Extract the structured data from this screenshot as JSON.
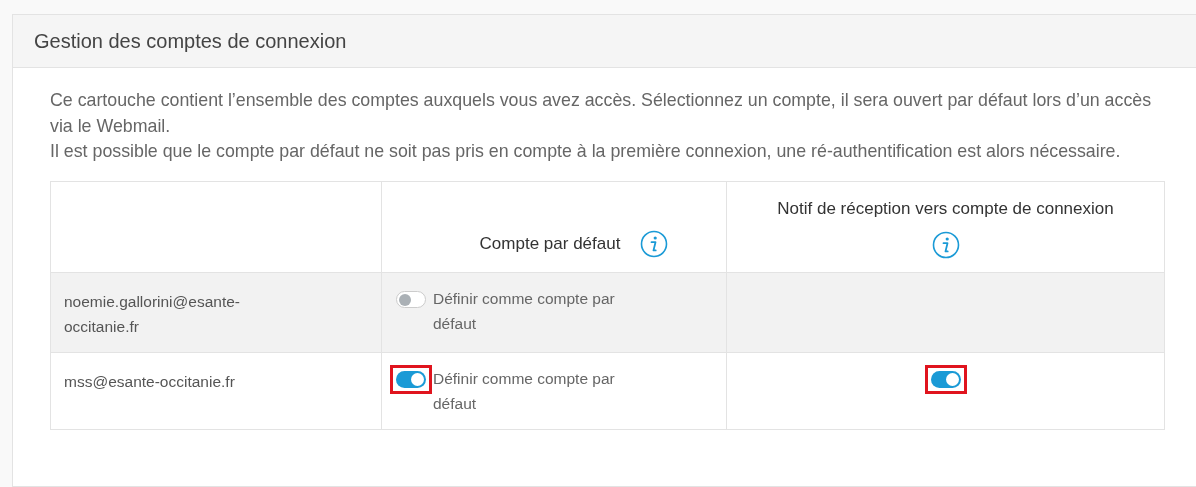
{
  "panel": {
    "title": "Gestion des comptes de connexion"
  },
  "paragraphs": [
    "Ce cartouche contient l’ensemble des comptes auxquels vous avez accès. Sélectionnez un compte, il sera ouvert par défaut lors d’un accès via le Webmail.",
    "Il est possible que le compte par défaut ne soit pas pris en compte à la première connexion, une ré-authentification est alors nécessaire."
  ],
  "table": {
    "columns": [
      {
        "label": "Compte par défaut",
        "info": true
      },
      {
        "label": "Notif de réception vers compte de connexion",
        "info": true
      }
    ],
    "rows": [
      {
        "account": "noemie.gallorini@esante-occitanie.fr",
        "default_toggle": {
          "on": false,
          "highlighted": false,
          "label": "Définir comme compte par défaut"
        }
      },
      {
        "account": "mss@esante-occitanie.fr",
        "default_toggle": {
          "on": true,
          "highlighted": true,
          "label": "Définir comme compte par défaut"
        },
        "notif_toggle": {
          "on": true,
          "highlighted": true
        }
      }
    ]
  }
}
